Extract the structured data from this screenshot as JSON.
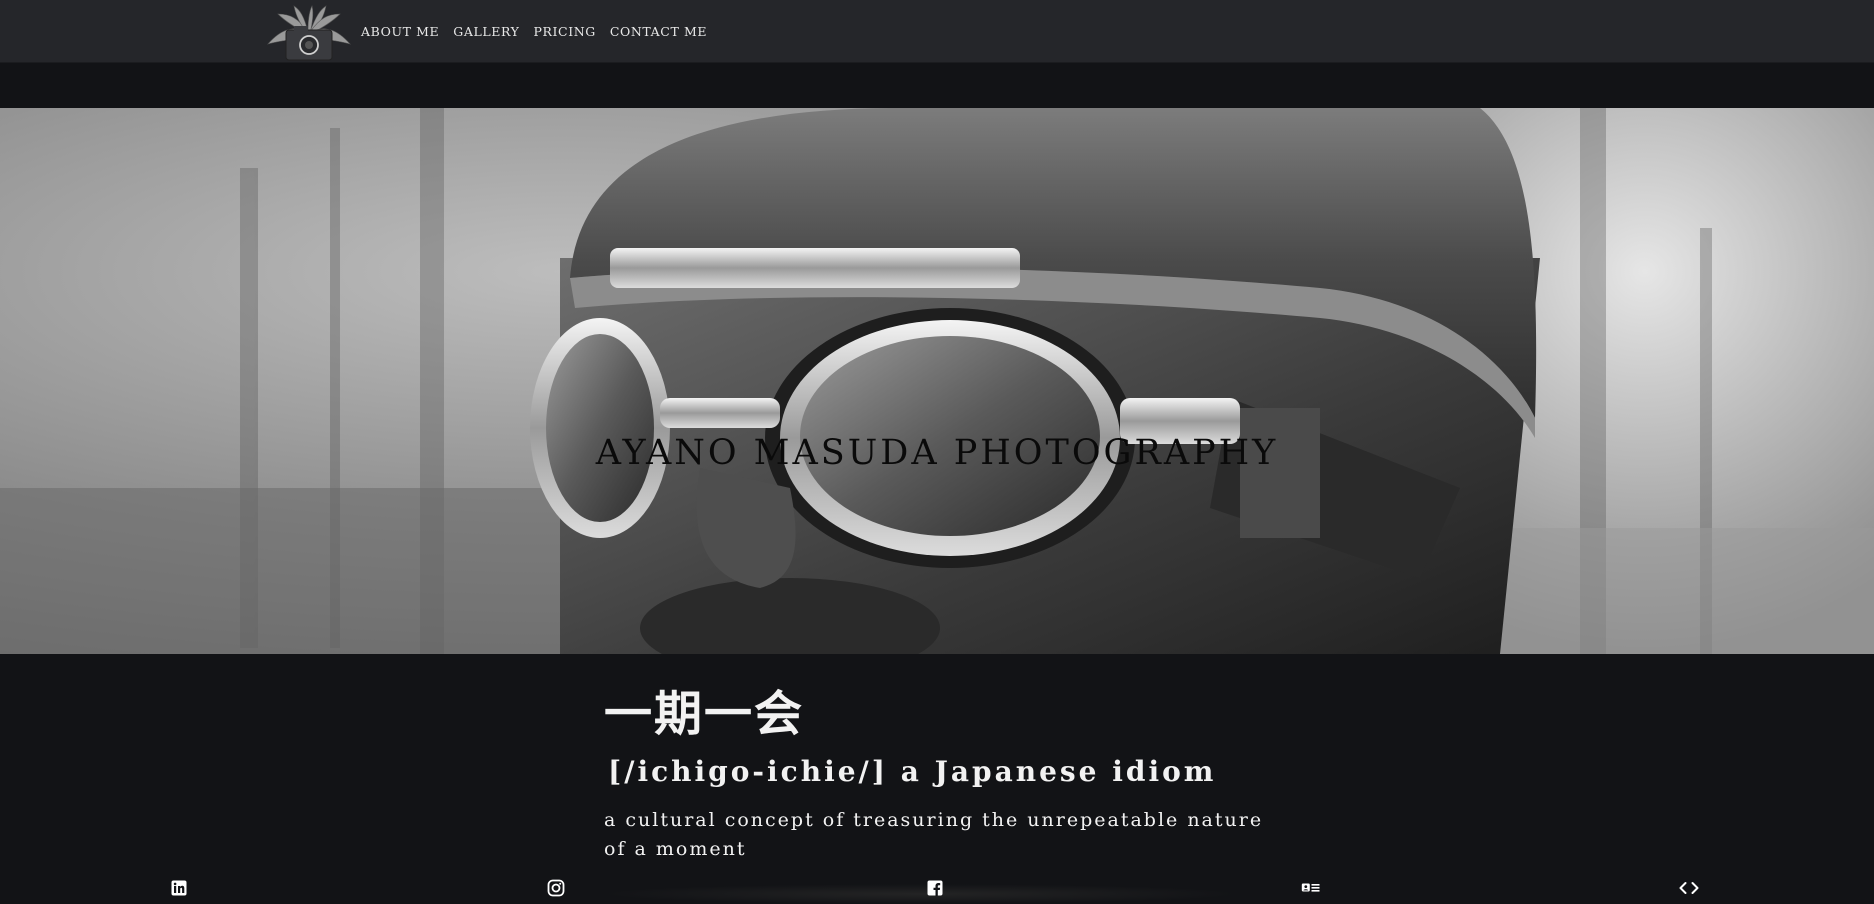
{
  "nav": {
    "links": [
      "ABOUT ME",
      "GALLERY",
      "PRICING",
      "CONTACT ME"
    ]
  },
  "hero": {
    "title": "AYANO MASUDA PHOTOGRAPHY"
  },
  "content": {
    "idiom": "一期一会",
    "reading": "[/ichigo-ichie/] a Japanese idiom",
    "definition": "a cultural concept of treasuring the unrepeatable nature of a moment"
  },
  "footer": {
    "icons": [
      "linkedin-icon",
      "instagram-icon",
      "facebook-icon",
      "resume-card-icon",
      "code-icon"
    ]
  },
  "colors": {
    "navbar_bg": "#25262a",
    "page_bg": "#121316",
    "text_light": "#f2f2f2"
  }
}
